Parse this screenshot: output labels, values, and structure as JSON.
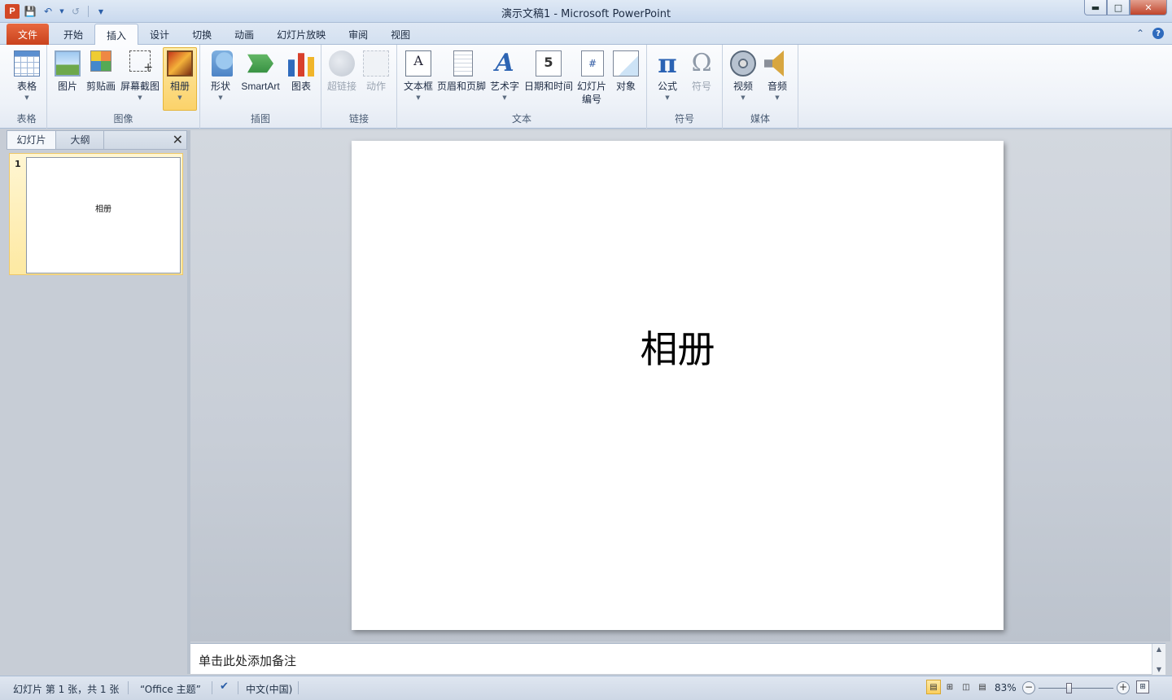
{
  "window": {
    "title": "演示文稿1 - Microsoft PowerPoint",
    "app_logo": "P"
  },
  "tabs": {
    "file": "文件",
    "items": [
      "开始",
      "插入",
      "设计",
      "切换",
      "动画",
      "幻灯片放映",
      "审阅",
      "视图"
    ],
    "active": "插入"
  },
  "ribbon": {
    "groups": {
      "tables": "表格",
      "images": "图像",
      "illustrations": "插图",
      "links": "链接",
      "text": "文本",
      "symbols": "符号",
      "media": "媒体"
    },
    "buttons": {
      "table": "表格",
      "picture": "图片",
      "clipart": "剪贴画",
      "screenshot": "屏幕截图",
      "album": "相册",
      "shapes": "形状",
      "smartart": "SmartArt",
      "chart": "图表",
      "hyperlink": "超链接",
      "action": "动作",
      "textbox": "文本框",
      "header_footer": "页眉和页脚",
      "wordart": "艺术字",
      "datetime": "日期和时间",
      "slide_number_1": "幻灯片",
      "slide_number_2": "编号",
      "object": "对象",
      "equation": "公式",
      "symbol": "符号",
      "video": "视频",
      "audio": "音频"
    },
    "selected": "album"
  },
  "left_pane": {
    "tab_slides": "幻灯片",
    "tab_outline": "大纲",
    "close_glyph": "✕",
    "thumbnails": [
      {
        "number": "1",
        "title": "相册"
      }
    ]
  },
  "slide": {
    "title": "相册"
  },
  "notes": {
    "placeholder": "单击此处添加备注"
  },
  "status": {
    "slide_info": "幻灯片 第 1 张，共 1 张",
    "theme": "“Office 主题”",
    "language": "中文(中国)",
    "zoom": "83%",
    "zoom_value_percent": 83
  },
  "icons": {
    "save": "save-icon",
    "undo": "undo-icon",
    "redo": "redo-icon",
    "minimize": "minimize-icon",
    "maximize": "maximize-icon",
    "close": "close-icon",
    "help": "help-icon"
  }
}
